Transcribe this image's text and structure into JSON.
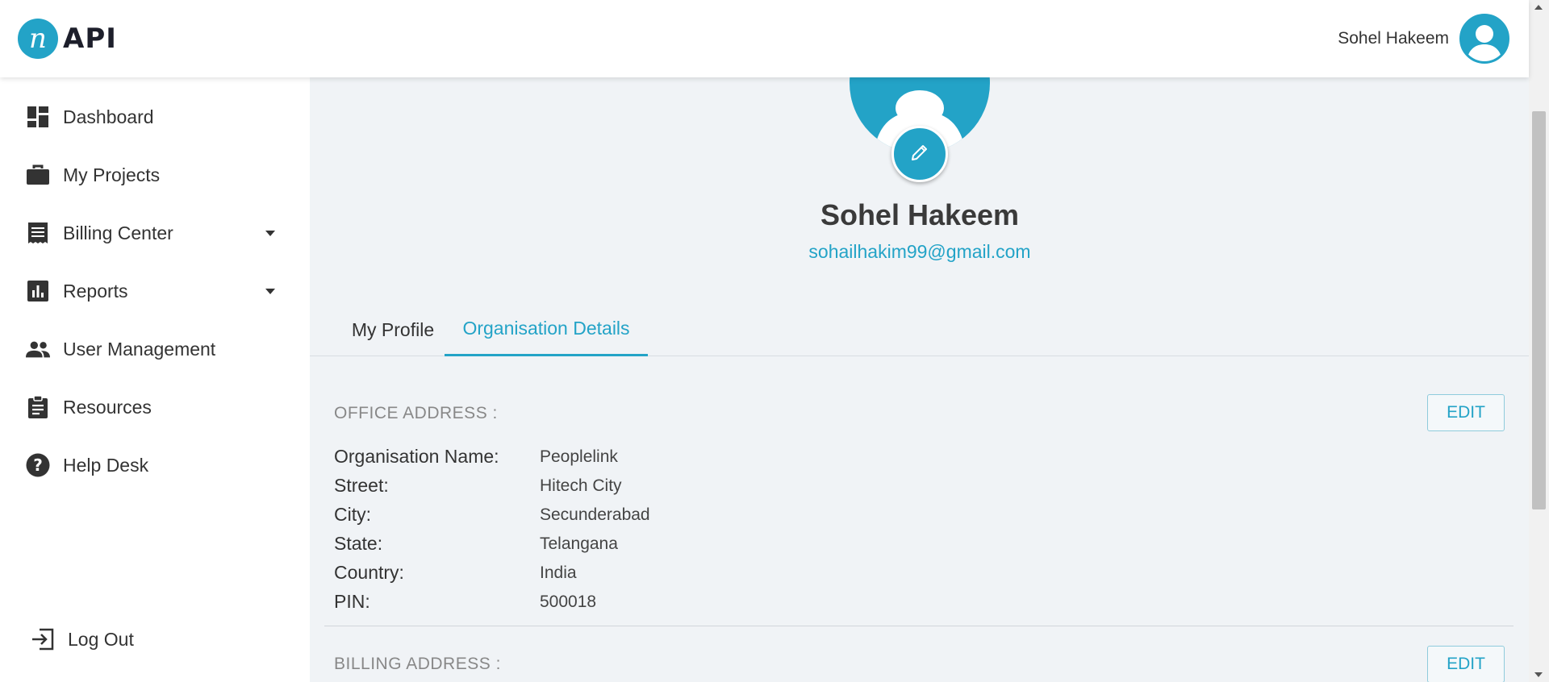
{
  "brand": {
    "logo_letter": "n",
    "logo_text": "API",
    "accent_color": "#23a3c7"
  },
  "header": {
    "user_name": "Sohel Hakeem",
    "avatar_icon": "user-avatar-icon"
  },
  "sidebar": {
    "items": [
      {
        "label": "Dashboard",
        "icon": "dashboard-icon"
      },
      {
        "label": "My Projects",
        "icon": "briefcase-icon"
      },
      {
        "label": "Billing Center",
        "icon": "receipt-icon",
        "has_dropdown": true
      },
      {
        "label": "Reports",
        "icon": "bar-chart-icon",
        "has_dropdown": true
      },
      {
        "label": "User Management",
        "icon": "people-icon"
      },
      {
        "label": "Resources",
        "icon": "clipboard-icon"
      },
      {
        "label": "Help Desk",
        "icon": "help-icon"
      }
    ],
    "logout_label": "Log Out"
  },
  "profile": {
    "name": "Sohel Hakeem",
    "email": "sohailhakim99@gmail.com"
  },
  "tabs": [
    {
      "label": "My Profile",
      "active": false
    },
    {
      "label": "Organisation Details",
      "active": true
    }
  ],
  "office_address": {
    "title": "OFFICE ADDRESS :",
    "edit_label": "EDIT",
    "fields": [
      {
        "label": "Organisation Name:",
        "value": "Peoplelink"
      },
      {
        "label": "Street:",
        "value": "Hitech City"
      },
      {
        "label": "City:",
        "value": "Secunderabad"
      },
      {
        "label": "State:",
        "value": "Telangana"
      },
      {
        "label": "Country:",
        "value": "India"
      },
      {
        "label": "PIN:",
        "value": "500018"
      }
    ]
  },
  "billing_address": {
    "title": "BILLING ADDRESS :",
    "edit_label": "EDIT"
  }
}
